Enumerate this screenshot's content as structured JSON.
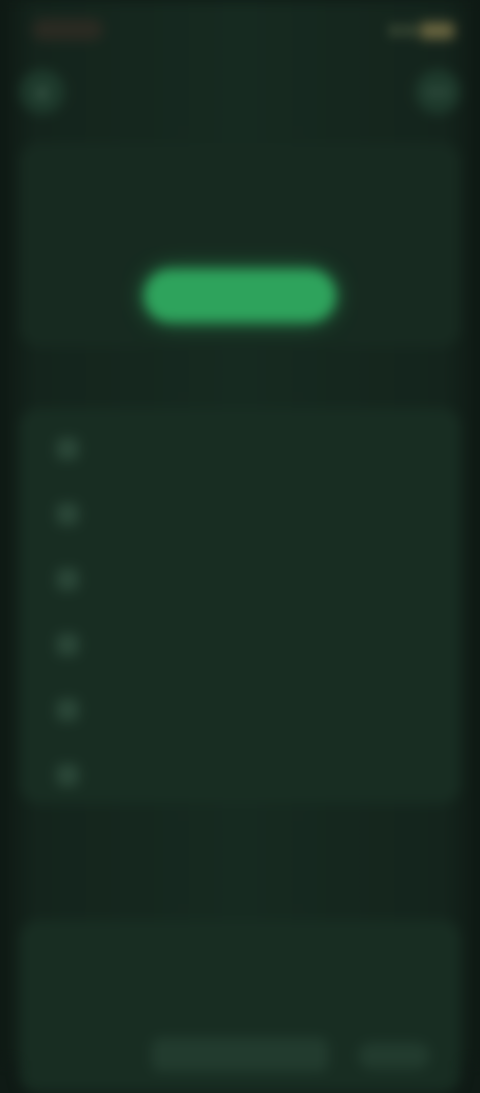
{
  "status": {
    "time": "",
    "signal_icon": "signal-icon",
    "battery_icon": "battery-icon"
  },
  "header": {
    "back_icon": "chevron-left-icon",
    "title": "",
    "more_icon": "more-icon"
  },
  "hero": {
    "title": "",
    "subtitle": "",
    "primary_button": ""
  },
  "sections": {
    "list_title": "",
    "rows": [
      {
        "label": "",
        "value": ""
      },
      {
        "label": "",
        "value": ""
      },
      {
        "label": "",
        "value": ""
      },
      {
        "label": "",
        "value": ""
      },
      {
        "label": "",
        "value": ""
      },
      {
        "label": "",
        "value": ""
      }
    ],
    "note": "",
    "panel_title": "",
    "panel": {
      "row1_label": "",
      "row1_value": "",
      "row2_label": "",
      "input_value": "",
      "button_label": ""
    }
  },
  "colors": {
    "accent": "#2ea35c",
    "background": "#0f1a15",
    "card": "#182d22"
  }
}
